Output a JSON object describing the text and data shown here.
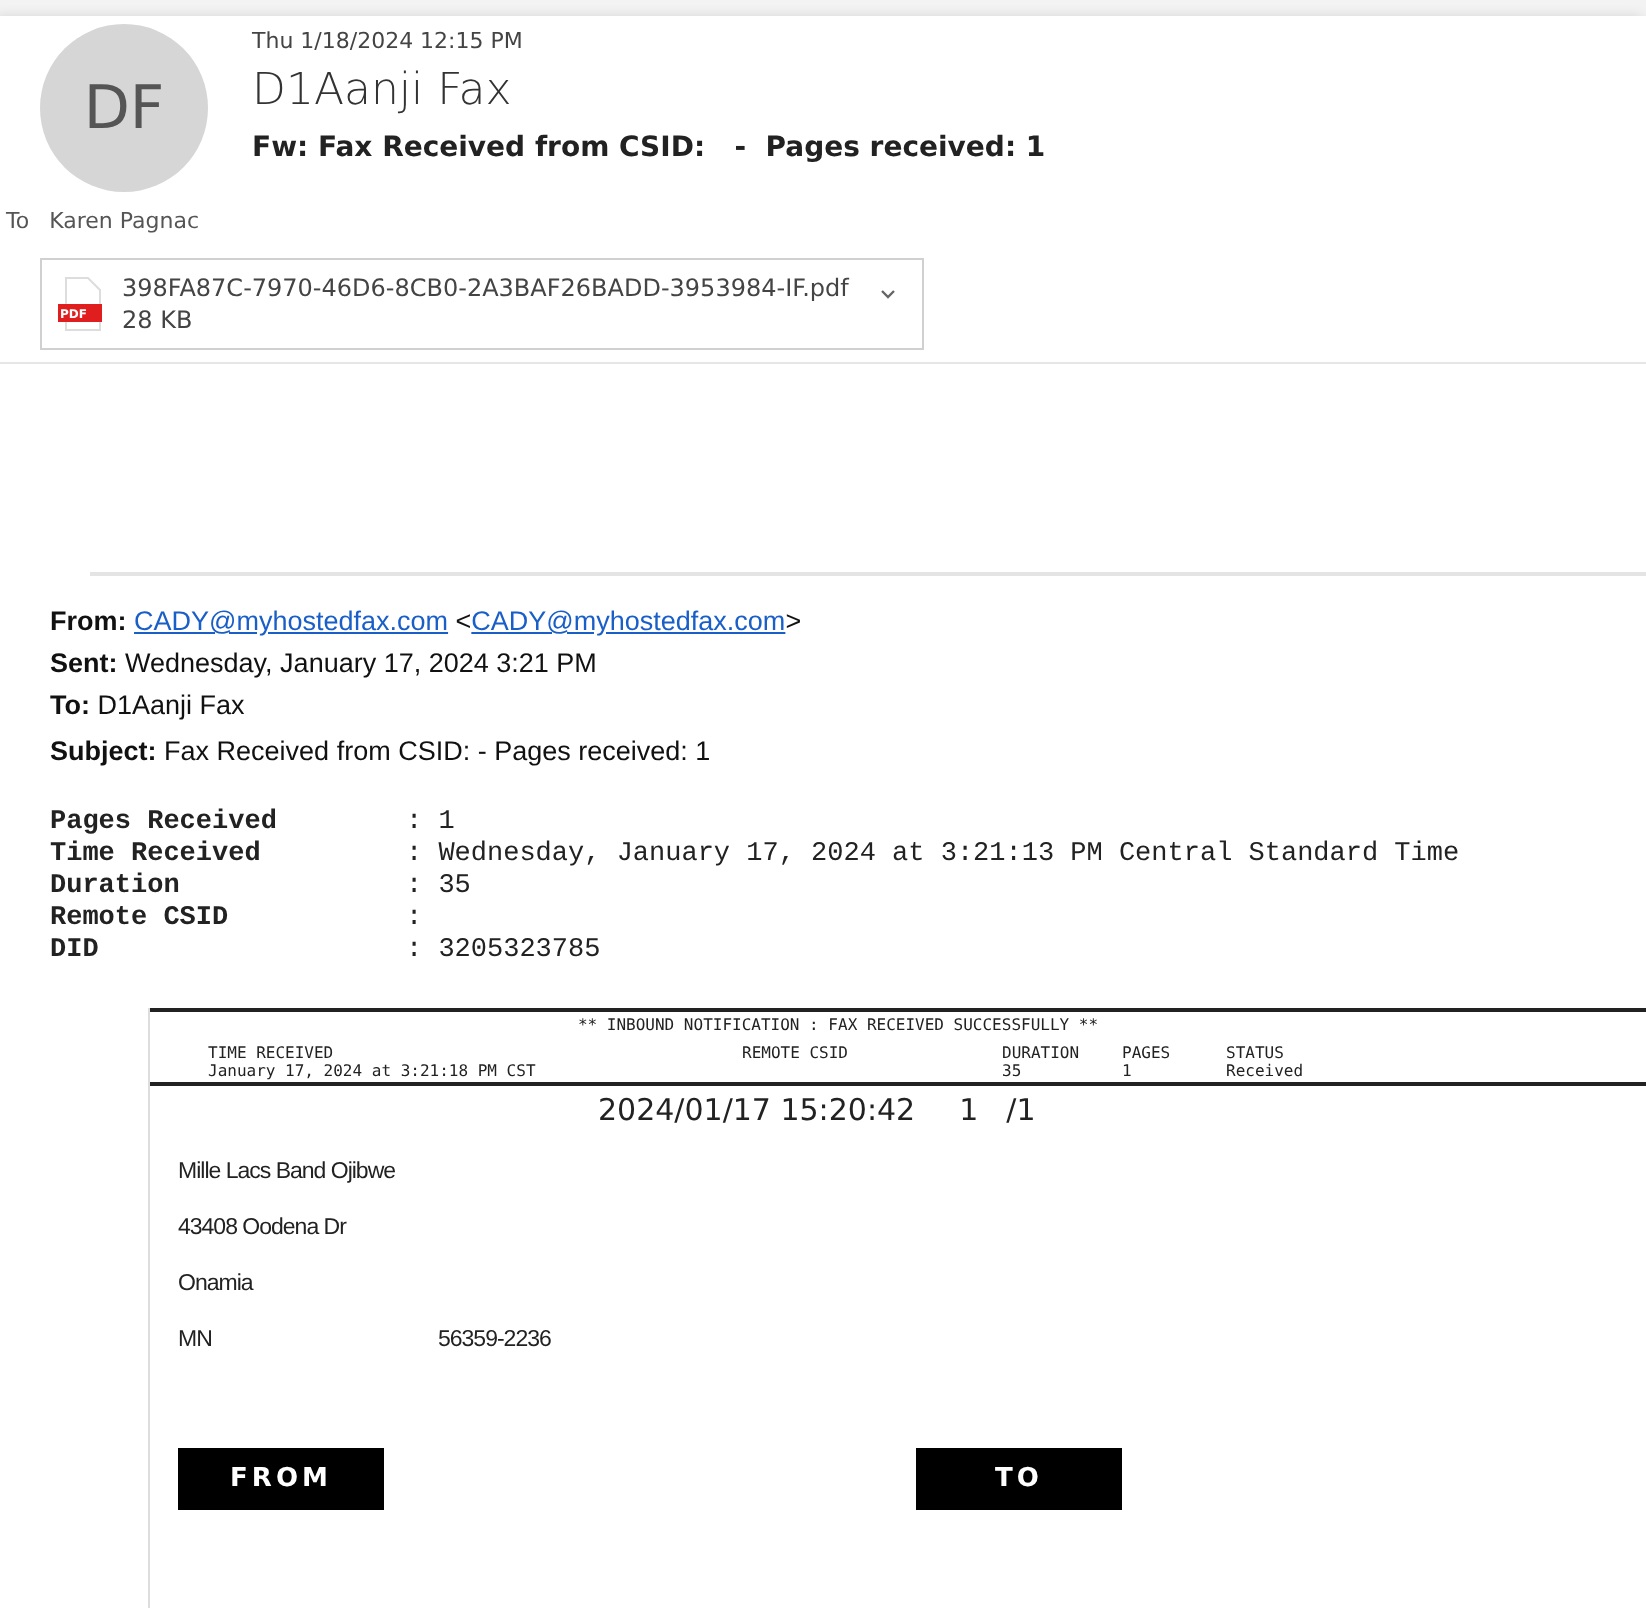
{
  "header": {
    "avatar_initials": "DF",
    "date": "Thu 1/18/2024 12:15 PM",
    "sender": "D1Aanji Fax",
    "subject": "Fw: Fax Received from CSID:   -  Pages received: 1",
    "to_label": "To",
    "to_name": "Karen Pagnac"
  },
  "attachment": {
    "badge": "PDF",
    "filename": "398FA87C-7970-46D6-8CB0-2A3BAF26BADD-3953984-IF.pdf",
    "size": "28 KB"
  },
  "forwarded": [
    {
      "label": "From:",
      "parts": [
        {
          "kind": "link",
          "text": "CADY@myhostedfax.com"
        },
        {
          "kind": "text",
          "text": " <"
        },
        {
          "kind": "link",
          "text": "CADY@myhostedfax.com"
        },
        {
          "kind": "text",
          "text": ">"
        }
      ]
    },
    {
      "label": "Sent:",
      "parts": [
        {
          "kind": "text",
          "text": "Wednesday, January 17, 2024 3:21 PM"
        }
      ]
    },
    {
      "label": "To:",
      "parts": [
        {
          "kind": "text",
          "text": "D1Aanji Fax"
        }
      ]
    },
    {
      "label": "Subject:",
      "parts": [
        {
          "kind": "text",
          "text": "Fax Received from CSID: - Pages received: 1"
        }
      ]
    }
  ],
  "fax_summary": [
    {
      "label": "Pages Received",
      "value": ": 1"
    },
    {
      "label": "Time Received",
      "value": ": Wednesday, January 17, 2024 at 3:21:13 PM Central Standard Time"
    },
    {
      "label": "Duration",
      "value": ": 35"
    },
    {
      "label": "Remote CSID",
      "value": ":"
    },
    {
      "label": "DID",
      "value": ": 3205323785"
    }
  ],
  "fax_page": {
    "banner": "** INBOUND NOTIFICATION : FAX RECEIVED SUCCESSFULLY **",
    "columns": [
      {
        "heading": "TIME RECEIVED",
        "value": "January 17, 2024 at 3:21:18 PM CST"
      },
      {
        "heading": "REMOTE CSID"
      },
      {
        "heading": "DURATION",
        "value": "35"
      },
      {
        "heading": "PAGES",
        "value": "1"
      },
      {
        "heading": "STATUS",
        "value": "Received"
      }
    ],
    "stamp": "2024/01/17 15:20:42",
    "page_no": "1",
    "page_total": "/1",
    "address_lines": [
      {
        "texts": [
          "Mille Lacs Band Ojibwe"
        ]
      },
      {
        "texts": [
          "43408 Oodena Dr"
        ]
      },
      {
        "texts": [
          "Onamia"
        ]
      },
      {
        "texts": [
          "MN",
          "56359-2236"
        ]
      }
    ],
    "from_tag": "FROM",
    "to_tag": "TO"
  }
}
